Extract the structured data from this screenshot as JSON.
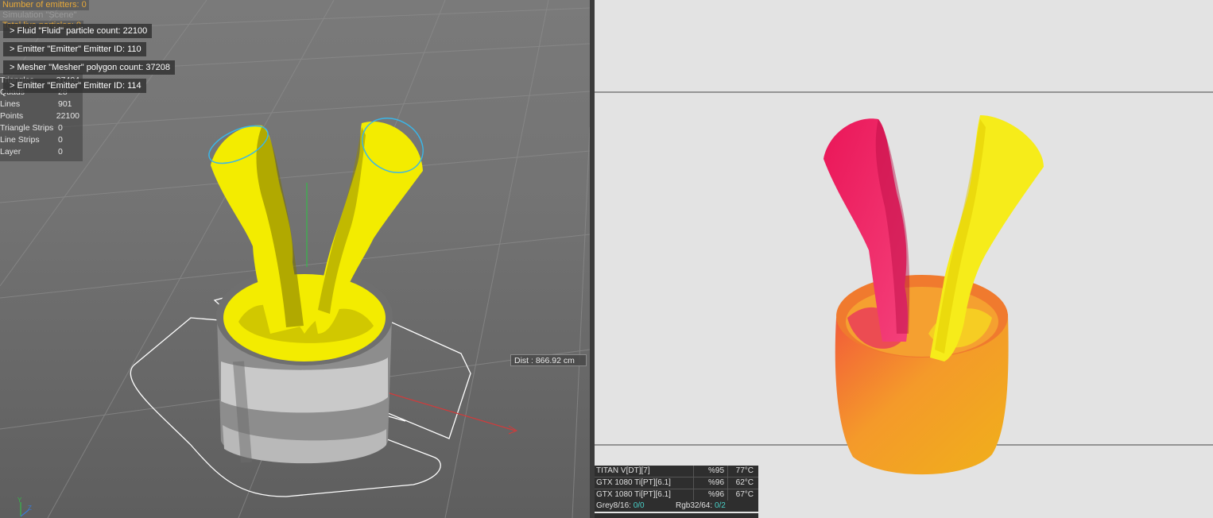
{
  "viewport": {
    "hud": {
      "emitters": "Number of emitters: 0",
      "simulation": "Simulation \"Scene\"",
      "live_particles": "Total live particles: 0"
    },
    "info_rows": [
      "> Fluid \"Fluid\" particle count: 22100",
      "> Emitter \"Emitter\" Emitter ID: 110",
      "> Mesher \"Mesher\" polygon count: 37208",
      "> Emitter \"Emitter\" Emitter ID: 114"
    ],
    "poly_stats": [
      {
        "label": "Triangles",
        "value": "37404"
      },
      {
        "label": "Quads",
        "value": "28"
      },
      {
        "label": "Lines",
        "value": "901"
      },
      {
        "label": "Points",
        "value": "22100"
      },
      {
        "label": "Triangle Strips",
        "value": "0"
      },
      {
        "label": "Line Strips",
        "value": "0"
      },
      {
        "label": "Layer",
        "value": "0"
      }
    ],
    "distance": "Dist : 866.92 cm",
    "axis_labels": {
      "y": "Y",
      "z": "Z"
    }
  },
  "render_view": {
    "gpus": [
      {
        "name": "TITAN V[DT][7]",
        "usage": "%95",
        "temp": "77°C"
      },
      {
        "name": "GTX 1080 Ti[PT][6.1]",
        "usage": "%96",
        "temp": "62°C"
      },
      {
        "name": "GTX 1080 Ti[PT][6.1]",
        "usage": "%96",
        "temp": "67°C"
      }
    ],
    "memory": {
      "grey_label": "Grey8/16:",
      "grey_value": "0/0",
      "rgb_label": "Rgb32/64:",
      "rgb_value": "0/2"
    }
  },
  "colors": {
    "fluid_yellow": "#f2ea00",
    "fluid_magenta": "#e8185c",
    "cup_orange": "#f08a28",
    "hud_orange": "#e7a93a",
    "emitter_blue": "#3ab6e8"
  }
}
